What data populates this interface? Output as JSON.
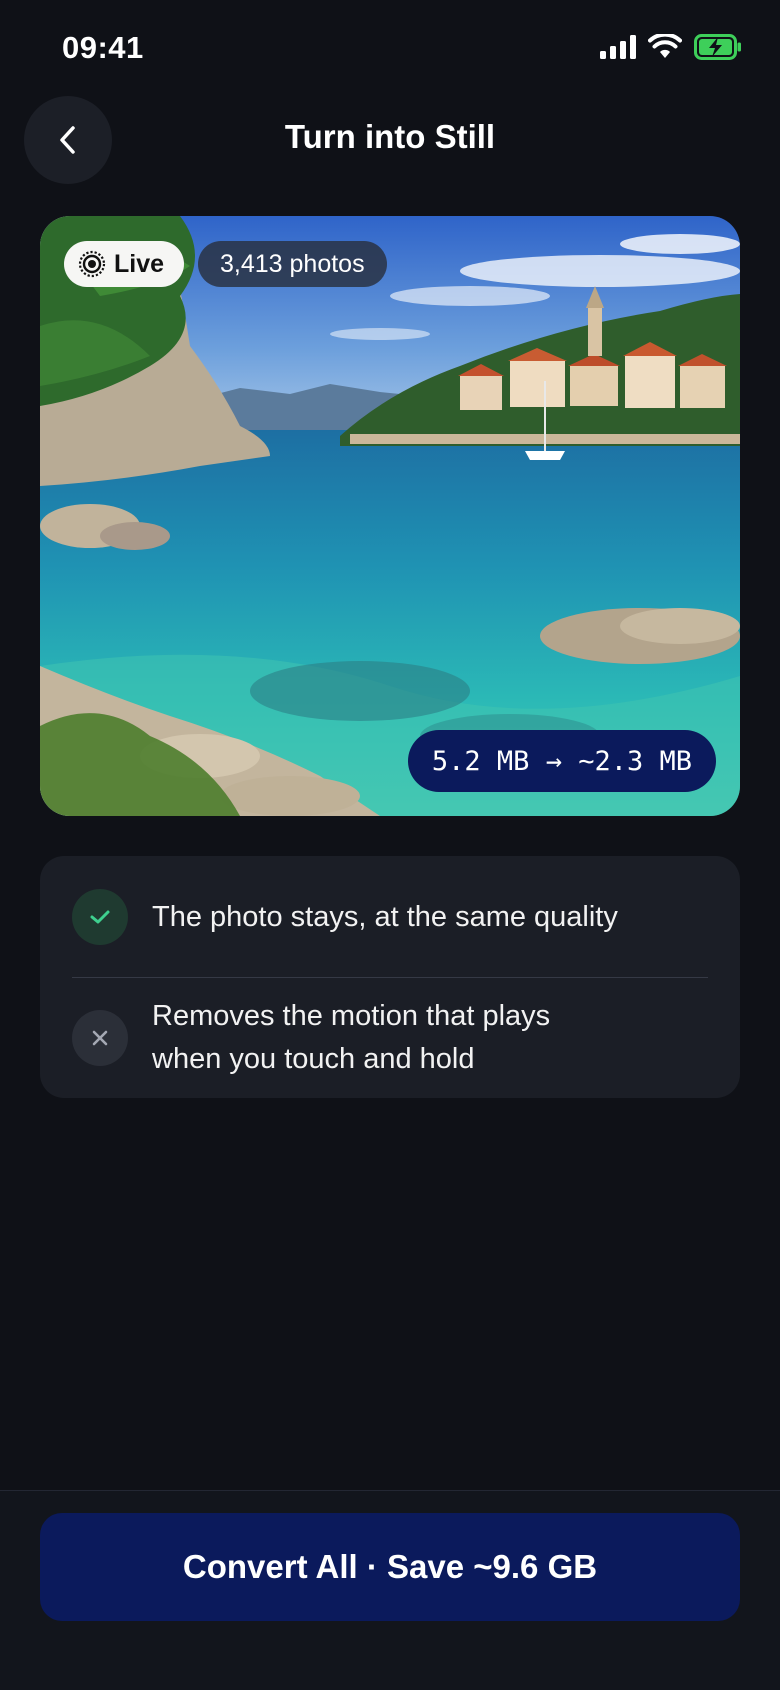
{
  "status_bar": {
    "time": "09:41"
  },
  "header": {
    "title": "Turn into Still"
  },
  "photo": {
    "live_label": "Live",
    "photo_count": "3,413 photos",
    "size_change": "5.2 MB → ~2.3 MB"
  },
  "info": {
    "keeps": "The photo stays, at the same quality",
    "removes_line1": "Removes the motion that plays",
    "removes_line2": "when you touch and hold"
  },
  "actions": {
    "convert_label": "Convert All · Save ~9.6 GB"
  },
  "colors": {
    "accent": "#0b1a5c",
    "success": "#3ecf8e",
    "background": "#0f1117",
    "card": "#1b1e26"
  }
}
